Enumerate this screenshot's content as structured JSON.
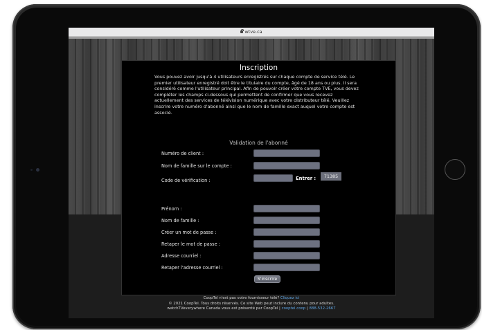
{
  "browser": {
    "url": "wtve.ca"
  },
  "page": {
    "title": "Inscription",
    "intro": "Vous pouvez avoir jusqu'à 4 utilisateurs enregistrés sur chaque compte de service télé. Le premier utilisateur enregistré doit être le titulaire du compte, âgé de 18 ans ou plus. Il sera considéré comme l'utilisateur principal. Afin de pouvoir créer votre compte TVE, vous devez compléter les champs ci-dessous qui permettent de confirmer que vous recevez actuellement des services de télévision numérique avec votre distributeur télé. Veuillez inscrire votre numéro d'abonné ainsi que le nom de famille exact auquel votre compte est associé."
  },
  "validation": {
    "section_title": "Validation de l'abonné",
    "fields": [
      {
        "label": "Numéro de client :",
        "value": ""
      },
      {
        "label": "Nom de famille sur le compte :",
        "value": ""
      },
      {
        "label": "Code de vérification :",
        "value": ""
      }
    ],
    "captcha_prompt": "Entrer :",
    "captcha_code": "71385"
  },
  "account": {
    "fields": [
      {
        "label": "Prénom :",
        "value": ""
      },
      {
        "label": "Nom de famille :",
        "value": ""
      },
      {
        "label": "Créer un mot de passe :",
        "value": ""
      },
      {
        "label": "Retaper le mot de passe :",
        "value": ""
      },
      {
        "label": "Adresse courriel :",
        "value": ""
      },
      {
        "label": "Retaper l'adresse courriel :",
        "value": ""
      }
    ],
    "submit_label": "S'inscrire"
  },
  "footer": {
    "line1_text": "CoopTel n'est pas votre fournisseur télé?",
    "line1_link": "Cliquez ici",
    "line2": "© 2021 CoopTel. Tous droits réservés. Ce site Web peut inclure du contenu pour adultes.",
    "line3_text": "watchTVeverywhere Canada vous est présenté par CoopTel |",
    "line3_link1": "cooptel.coop",
    "line3_sep": "|",
    "line3_link2": "888-532-2667"
  },
  "colors": {
    "panel_bg": "#000000",
    "field_bg": "#6d7180",
    "link": "#5fa3e0"
  }
}
